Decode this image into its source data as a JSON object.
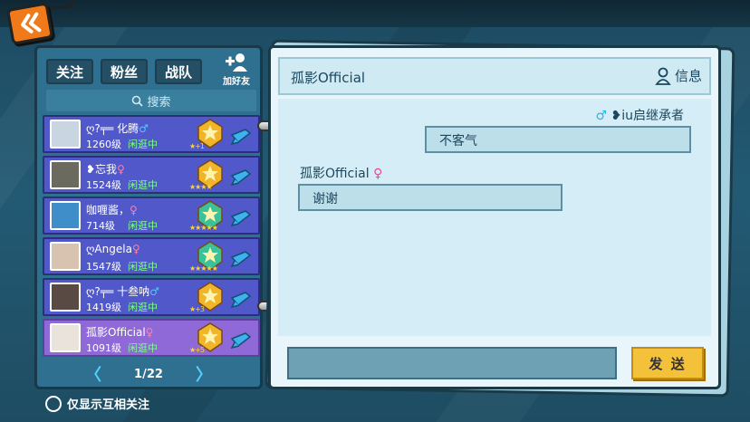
{
  "tabs": [
    {
      "label": "关注",
      "active": true
    },
    {
      "label": "粉丝",
      "active": false
    },
    {
      "label": "战队",
      "active": false
    }
  ],
  "add_friend_label": "加好友",
  "search_placeholder": "搜索",
  "friends": [
    {
      "name": "ღ?╤═ 化腾",
      "gender": "♂",
      "level": "1260级",
      "status": "闲逛中",
      "stars": "★+1",
      "avatar_color": "#c9d6e2",
      "rank_color": "#f1b52a",
      "selected": false
    },
    {
      "name": "❥忘我",
      "gender": "♀",
      "level": "1524级",
      "status": "闲逛中",
      "stars": "★★★★",
      "avatar_color": "#6b6a5e",
      "rank_color": "#f1b52a",
      "selected": false
    },
    {
      "name": "咖喱酱，",
      "gender": "♀",
      "level": "714级",
      "status": "闲逛中",
      "stars": "★★★★★",
      "avatar_color": "#3f8ec9",
      "rank_color": "#3ac29a",
      "selected": false
    },
    {
      "name": "ღAngela",
      "gender": "♀",
      "level": "1547级",
      "status": "闲逛中",
      "stars": "★★★★★",
      "avatar_color": "#d8c2b0",
      "rank_color": "#3ac29a",
      "selected": false
    },
    {
      "name": "ღ?╤═ 十叁呐",
      "gender": "♂",
      "level": "1419级",
      "status": "闲逛中",
      "stars": "★+3",
      "avatar_color": "#5a4a44",
      "rank_color": "#f1b52a",
      "selected": false
    },
    {
      "name": "孤影Official",
      "gender": "♀",
      "level": "1091级",
      "status": "闲逛中",
      "stars": "★+5",
      "avatar_color": "#e9e3dc",
      "rank_color": "#f1b52a",
      "selected": true
    }
  ],
  "pager": {
    "prev": "〈",
    "label": "1/22",
    "next": "〉"
  },
  "mutual_only_label": "仅显示互相关注",
  "chat": {
    "title": "孤影Official",
    "info_label": "信息",
    "messages": [
      {
        "sender": "❥iu启继承者",
        "gender": "♂",
        "text": "不客气",
        "side": "right"
      },
      {
        "sender": "孤影Official",
        "gender": "♀",
        "text": "谢谢",
        "side": "left"
      }
    ],
    "send_label": "发 送"
  }
}
